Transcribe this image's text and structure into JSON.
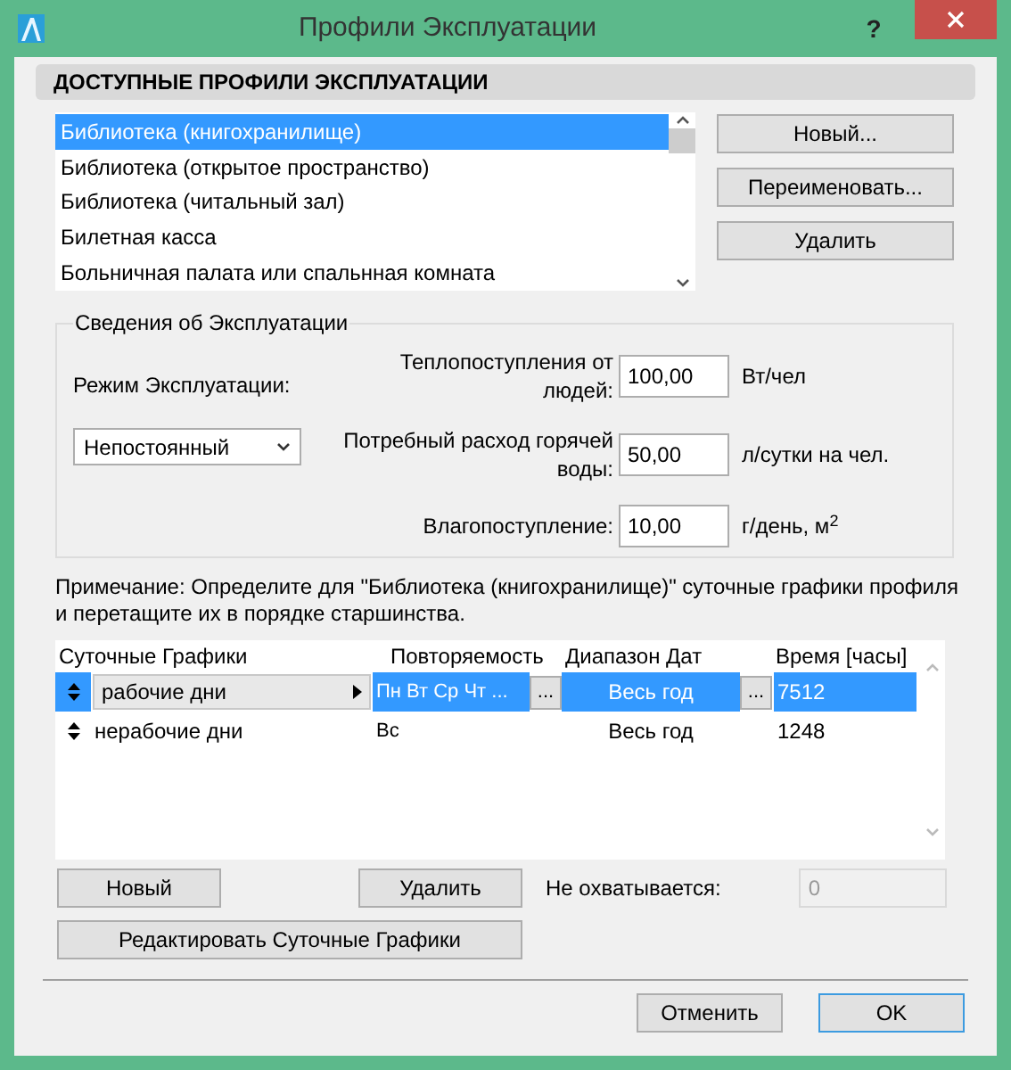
{
  "window": {
    "title": "Профили Эксплуатации",
    "help": "?"
  },
  "profiles": {
    "header": "ДОСТУПНЫЕ ПРОФИЛИ ЭКСПЛУАТАЦИИ",
    "items": [
      {
        "label": "Библиотека (книгохранилище)",
        "selected": true
      },
      {
        "label": "Библиотека (открытое пространство)",
        "selected": false
      },
      {
        "label": "Библиотека (читальный зал)",
        "selected": false
      },
      {
        "label": "Билетная касса",
        "selected": false
      },
      {
        "label": "Больничная палата или спальнная комната",
        "selected": false
      }
    ],
    "buttons": [
      "Новый...",
      "Переименовать...",
      "Удалить"
    ]
  },
  "operation": {
    "title": "Сведения об Эксплуатации",
    "mode_label": "Режим Эксплуатации:",
    "mode_value": "Непостоянный",
    "fields": [
      {
        "label": "Теплопоступления от людей:",
        "value": "100,00",
        "unit": "Вт/чел"
      },
      {
        "label": "Потребный расход горячей воды:",
        "value": "50,00",
        "unit": "л/сутки на чел."
      },
      {
        "label": "Влагопоступление:",
        "value": "10,00",
        "unit": "г/день, м$^{2}$"
      }
    ]
  },
  "note": "Примечание: Определите для \"Библиотека (книгохранилище)\" суточные графики профиля и перетащите их в порядке старшинства.",
  "schedule": {
    "columns": [
      "Суточные Графики",
      "Повторяемость",
      "Диапазон Дат",
      "Время [часы]"
    ],
    "rows": [
      {
        "name": "рабочие дни",
        "repeat": "Пн Вт Ср Чт ...",
        "range": "Весь год",
        "hours": "7512",
        "selected": true
      },
      {
        "name": "нерабочие дни",
        "repeat": "Вс",
        "range": "Весь год",
        "hours": "1248",
        "selected": false
      }
    ],
    "dots": "...",
    "new_button": "Новый",
    "delete_button": "Удалить",
    "edit_button": "Редактировать Суточные Графики",
    "uncovered_label": "Не охватывается:",
    "uncovered_value": "0",
    "uncovered_disabled": true
  },
  "footer": {
    "cancel": "Отменить",
    "ok": "OK"
  }
}
